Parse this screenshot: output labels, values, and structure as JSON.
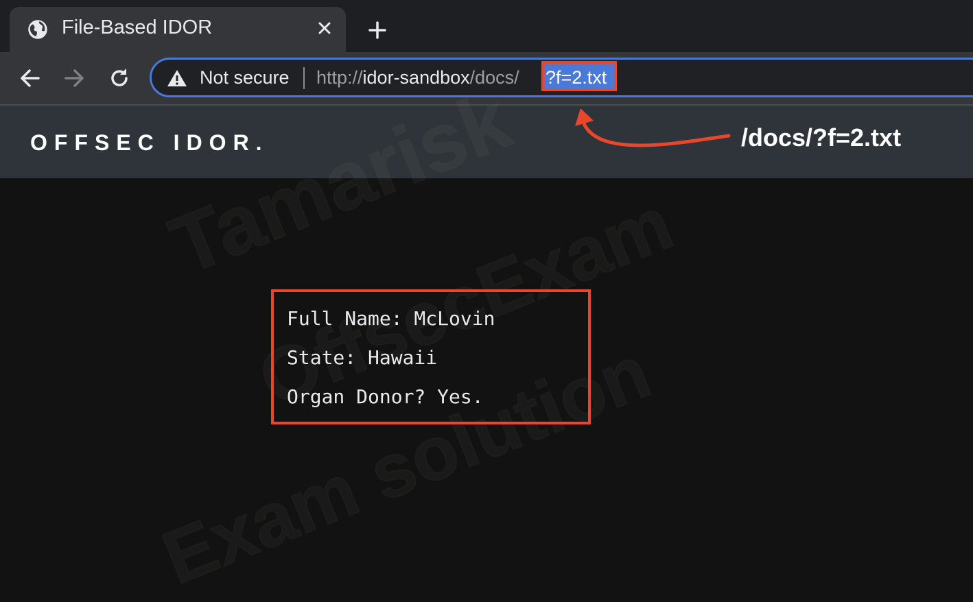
{
  "tab": {
    "title": "File-Based IDOR",
    "favicon": "globe-icon"
  },
  "address_bar": {
    "security_label": "Not secure",
    "url_prefix": "http://",
    "url_host": "idor-sandbox",
    "url_path": "/docs/",
    "url_query": "?f=2.txt"
  },
  "site": {
    "brand": "OFFSEC IDOR."
  },
  "annotation": {
    "callout": "/docs/?f=2.txt",
    "color": "#e8472b"
  },
  "document": {
    "lines": [
      "Full Name: McLovin",
      "State: Hawaii",
      "Organ Donor? Yes."
    ]
  },
  "watermark": {
    "lines": [
      "Tamarisk",
      "OffsecExam",
      "Exam solution"
    ]
  }
}
